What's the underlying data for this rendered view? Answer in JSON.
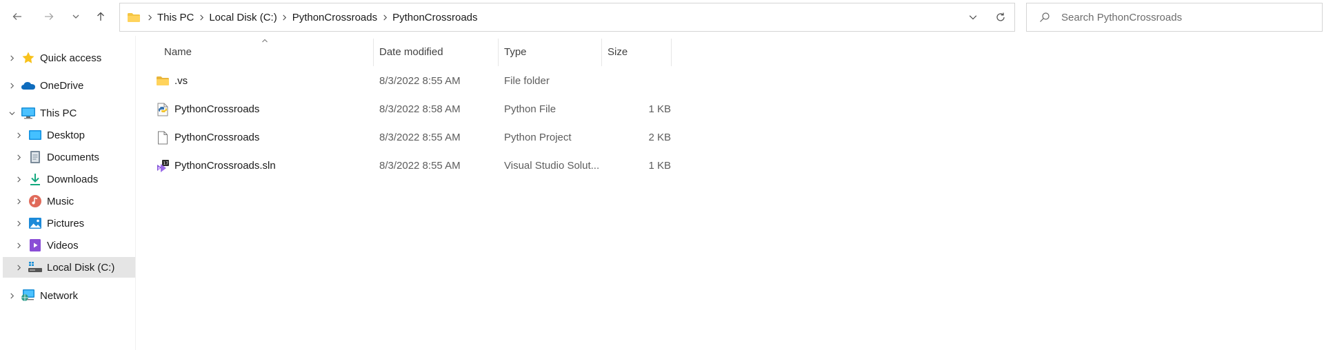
{
  "nav": {
    "back_icon": "arrow-left-icon",
    "forward_icon": "arrow-right-icon",
    "recent_icon": "chevron-down-icon",
    "up_icon": "arrow-up-icon"
  },
  "address": {
    "icon": "folder-icon",
    "breadcrumbs": [
      "This PC",
      "Local Disk (C:)",
      "PythonCrossroads",
      "PythonCrossroads"
    ]
  },
  "search": {
    "placeholder": "Search PythonCrossroads"
  },
  "sidebar": {
    "items": [
      {
        "label": "Quick access",
        "icon": "star-icon"
      },
      {
        "label": "OneDrive",
        "icon": "cloud-icon"
      },
      {
        "label": "This PC",
        "icon": "computer-icon"
      },
      {
        "label": "Desktop",
        "icon": "desktop-icon"
      },
      {
        "label": "Documents",
        "icon": "documents-icon"
      },
      {
        "label": "Downloads",
        "icon": "download-icon"
      },
      {
        "label": "Music",
        "icon": "music-icon"
      },
      {
        "label": "Pictures",
        "icon": "pictures-icon"
      },
      {
        "label": "Videos",
        "icon": "videos-icon"
      },
      {
        "label": "Local Disk (C:)",
        "icon": "drive-icon"
      },
      {
        "label": "Network",
        "icon": "network-icon"
      }
    ],
    "selected": "Local Disk (C:)"
  },
  "columns": {
    "name": "Name",
    "date": "Date modified",
    "type": "Type",
    "size": "Size"
  },
  "files": [
    {
      "name": ".vs",
      "date": "8/3/2022 8:55 AM",
      "type": "File folder",
      "size": "",
      "icon": "folder-icon"
    },
    {
      "name": "PythonCrossroads",
      "date": "8/3/2022 8:58 AM",
      "type": "Python File",
      "size": "1 KB",
      "icon": "python-file-icon"
    },
    {
      "name": "PythonCrossroads",
      "date": "8/3/2022 8:55 AM",
      "type": "Python Project",
      "size": "2 KB",
      "icon": "blank-file-icon"
    },
    {
      "name": "PythonCrossroads.sln",
      "date": "8/3/2022 8:55 AM",
      "type": "Visual Studio Solut...",
      "size": "1 KB",
      "icon": "vs-solution-icon"
    }
  ],
  "colors": {
    "selected_bg": "#e5e5e5",
    "folder": "#f4c542",
    "accent": "#0078d4"
  }
}
